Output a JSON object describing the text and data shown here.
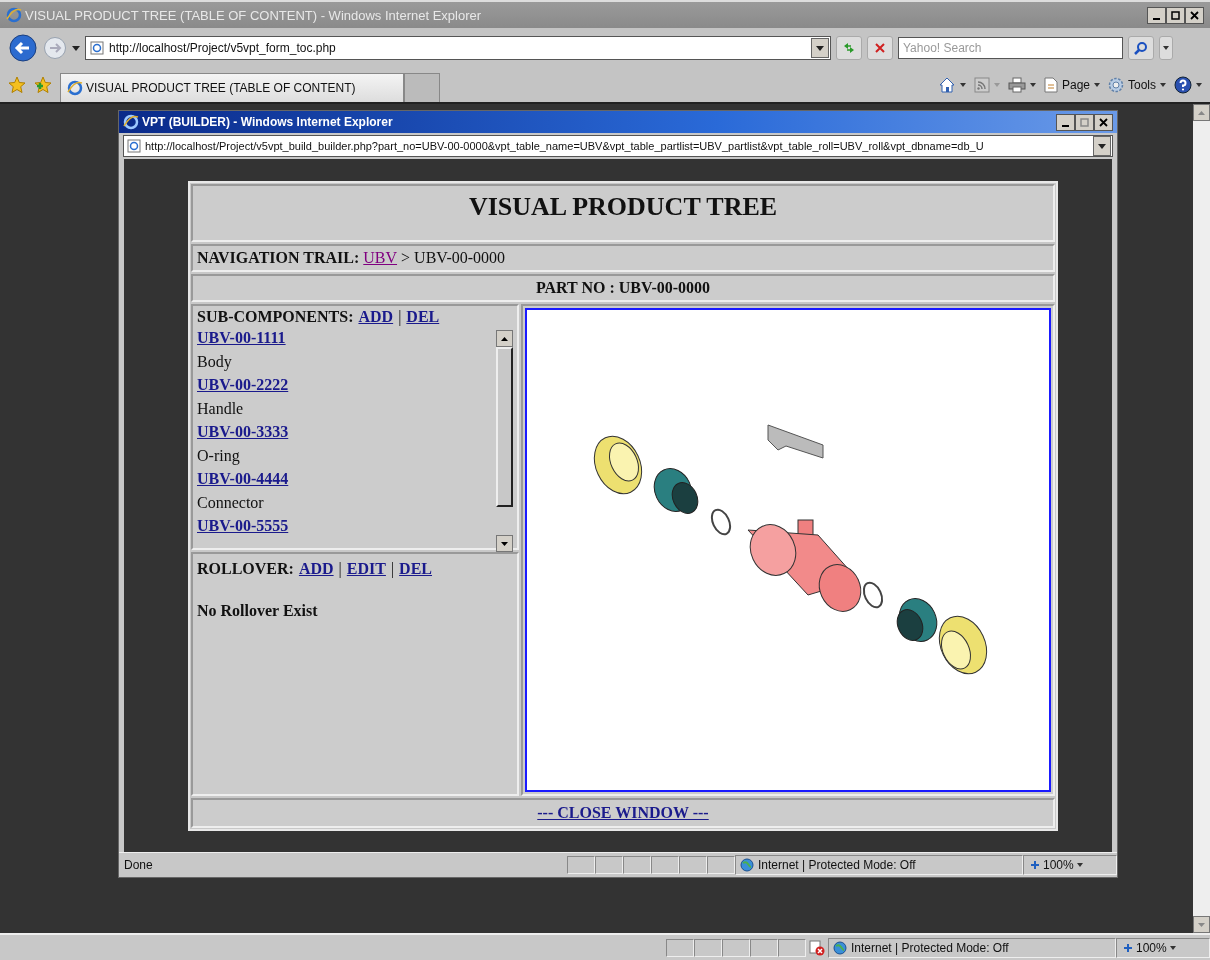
{
  "browser": {
    "title": "VISUAL PRODUCT TREE (TABLE OF CONTENT) - Windows Internet Explorer",
    "address": "http://localhost/Project/v5vpt_form_toc.php",
    "search": {
      "placeholder": "Yahoo! Search"
    },
    "tab": {
      "label": "VISUAL PRODUCT TREE (TABLE OF CONTENT)"
    },
    "commands": [
      "Page",
      "Tools"
    ],
    "status": {
      "zone": "Internet | Protected Mode: Off",
      "zoom": "100%"
    }
  },
  "popup": {
    "title": "VPT (BUILDER) - Windows Internet Explorer",
    "address": "http://localhost/Project/v5vpt_build_builder.php?part_no=UBV-00-0000&vpt_table_name=UBV&vpt_table_partlist=UBV_partlist&vpt_table_roll=UBV_roll&vpt_dbname=db_U",
    "status": {
      "text": "Done",
      "zone": "Internet | Protected Mode: Off",
      "zoom": "100%"
    }
  },
  "page": {
    "heading": "VISUAL PRODUCT TREE",
    "trail": {
      "label": "NAVIGATION TRAIL:",
      "link": "UBV",
      "rest": "> UBV-00-0000"
    },
    "part_no": "PART NO : UBV-00-0000",
    "subcomponents": {
      "label": "SUB-COMPONENTS:",
      "separator": "|",
      "actions": [
        "ADD",
        "DEL"
      ],
      "items": [
        {
          "part_no": "UBV-00-1111",
          "name": "Body"
        },
        {
          "part_no": "UBV-00-2222",
          "name": "Handle"
        },
        {
          "part_no": "UBV-00-3333",
          "name": "O-ring"
        },
        {
          "part_no": "UBV-00-4444",
          "name": "Connector"
        },
        {
          "part_no": "UBV-00-5555"
        }
      ]
    },
    "rollover": {
      "label": "ROLLOVER:",
      "separator": "|",
      "actions": [
        "ADD",
        "EDIT",
        "DEL"
      ],
      "message": "No Rollover Exist"
    },
    "close_link": "--- CLOSE WINDOW ---"
  }
}
